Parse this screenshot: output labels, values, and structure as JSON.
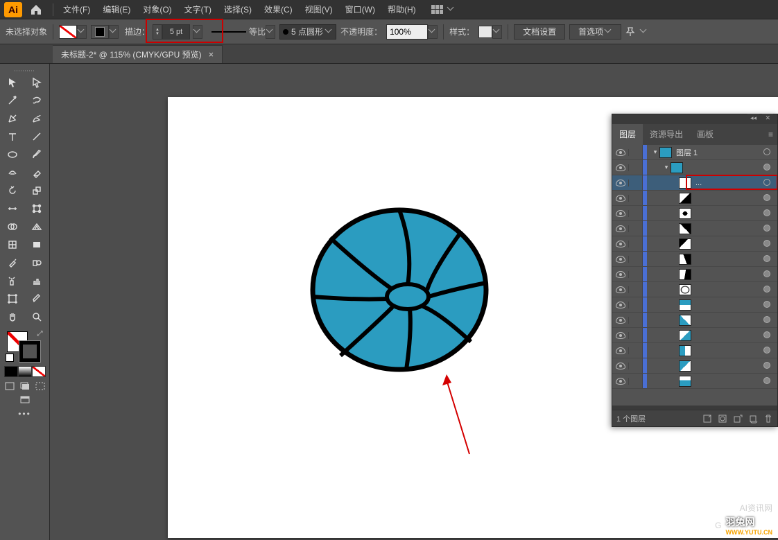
{
  "menubar": {
    "items": [
      "文件(F)",
      "编辑(E)",
      "对象(O)",
      "文字(T)",
      "选择(S)",
      "效果(C)",
      "视图(V)",
      "窗口(W)",
      "帮助(H)"
    ]
  },
  "controlbar": {
    "no_selection": "未选择对象",
    "stroke_label": "描边：",
    "stroke_value": "5 pt",
    "profile_label": "等比",
    "brush_label": "5 点圆形",
    "opacity_label": "不透明度：",
    "opacity_value": "100%",
    "style_label": "样式：",
    "doc_setup": "文档设置",
    "prefs": "首选项"
  },
  "tab": {
    "title": "未标题-2* @ 115% (CMYK/GPU 预览)"
  },
  "panel": {
    "tabs": [
      "图层",
      "资源导出",
      "画板"
    ],
    "layer_name": "图层 1",
    "sublayer_placeholder": "...",
    "footer_count": "1 个图层"
  },
  "watermark": {
    "ai_title": "AI资讯网",
    "yutu_text": "羽兔网",
    "yutu_url": "WWW.YUTU.CN"
  },
  "chart_data": null
}
